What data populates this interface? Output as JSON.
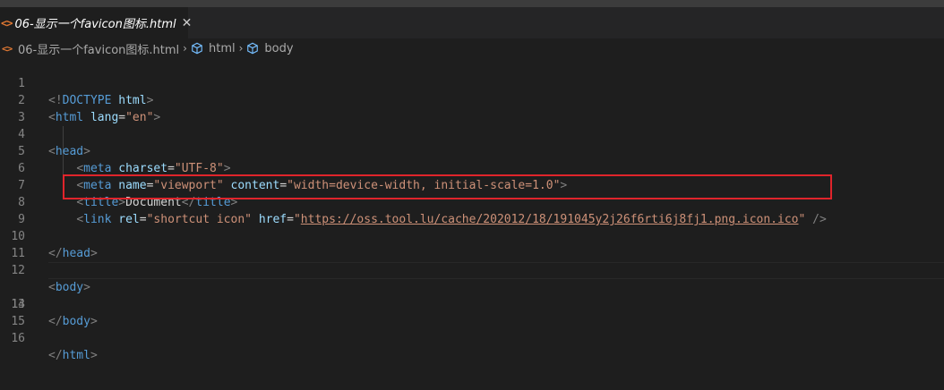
{
  "tab": {
    "icon_glyph": "<>",
    "label": "06-显示一个favicon图标.html",
    "close_glyph": "✕"
  },
  "breadcrumb": {
    "file_icon_glyph": "<>",
    "file": "06-显示一个favicon图标.html",
    "separator": "›",
    "items": [
      "html",
      "body"
    ]
  },
  "line_numbers": [
    "1",
    "2",
    "3",
    "4",
    "5",
    "6",
    "7",
    "8",
    "9",
    "10",
    "11",
    "12",
    "13",
    "14",
    "15",
    "16"
  ],
  "code": {
    "l1": {
      "open": "<!",
      "doctype": "DOCTYPE",
      "sp": " ",
      "html": "html",
      "close": ">"
    },
    "l2": {
      "open": "<",
      "tag": "html",
      "sp": " ",
      "attr": "lang",
      "eq": "=",
      "val": "\"en\"",
      "close": ">"
    },
    "l4": {
      "open": "<",
      "tag": "head",
      "close": ">"
    },
    "l5": {
      "indent": "    ",
      "open": "<",
      "tag": "meta",
      "sp": " ",
      "attr": "charset",
      "eq": "=",
      "val": "\"UTF-8\"",
      "close": ">"
    },
    "l6": {
      "indent": "    ",
      "open": "<",
      "tag": "meta",
      "sp": " ",
      "attr1": "name",
      "eq": "=",
      "val1": "\"viewport\"",
      "sp2": " ",
      "attr2": "content",
      "val2": "\"width=device-width, initial-scale=1.0\"",
      "close": ">"
    },
    "l7": {
      "indent": "    ",
      "open": "<",
      "tag": "title",
      "close": ">",
      "text": "Document",
      "open2": "</",
      "close2": ">"
    },
    "l8": {
      "indent": "    ",
      "open": "<",
      "tag": "link",
      "sp": " ",
      "attr1": "rel",
      "eq": "=",
      "val1": "\"shortcut icon\"",
      "sp2": " ",
      "attr2": "href",
      "q": "\"",
      "url": "https://oss.tool.lu/cache/202012/18/191045y2j26f6rti6j8fj1.png.icon.ico",
      "selfclose": " />"
    },
    "l10": {
      "open": "</",
      "tag": "head",
      "close": ">"
    },
    "l12": {
      "open": "<",
      "tag": "body",
      "close": ">"
    },
    "l14": {
      "open": "</",
      "tag": "body",
      "close": ">"
    },
    "l16": {
      "open": "</",
      "tag": "html",
      "close": ">"
    }
  },
  "colors": {
    "tag": "#569cd6",
    "bracket": "#808080",
    "attribute": "#9cdcfe",
    "string": "#ce9178",
    "text": "#d4d4d4",
    "highlight_box": "#e0242b",
    "html_file_icon": "#e37933"
  },
  "icons": {
    "tab_file": "html-file-icon",
    "breadcrumb_element": "symbol-cube-icon"
  }
}
